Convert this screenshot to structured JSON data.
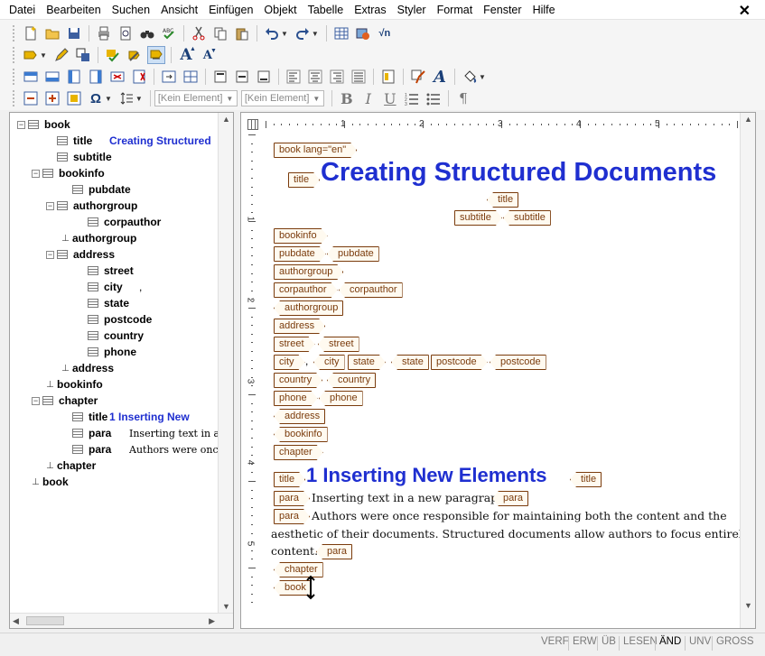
{
  "menu": [
    "Datei",
    "Bearbeiten",
    "Suchen",
    "Ansicht",
    "Einfügen",
    "Objekt",
    "Tabelle",
    "Extras",
    "Styler",
    "Format",
    "Fenster",
    "Hilfe"
  ],
  "window": {
    "close_glyph": "✕"
  },
  "toolbar": {
    "element_combo_1": "[Kein Element]",
    "element_combo_2": "[Kein Element]",
    "bold": "B",
    "italic": "I",
    "underline": "U",
    "pilcrow": "¶",
    "sqrt": "√n",
    "omega": "Ω"
  },
  "tree": {
    "nodes": [
      {
        "label": "book",
        "value": "",
        "expander": "minus"
      },
      {
        "label": "title",
        "value": "Creating Structured",
        "expander": "none"
      },
      {
        "label": "subtitle",
        "value": "",
        "expander": "none"
      },
      {
        "label": "bookinfo",
        "value": "",
        "expander": "minus"
      },
      {
        "label": "pubdate",
        "value": "",
        "expander": "none"
      },
      {
        "label": "authorgroup",
        "value": "",
        "expander": "minus"
      },
      {
        "label": "corpauthor",
        "value": "",
        "expander": "none"
      },
      {
        "label": "authorgroup",
        "value": "",
        "expander": "pin"
      },
      {
        "label": "address",
        "value": "",
        "expander": "minus"
      },
      {
        "label": "street",
        "value": "",
        "expander": "none"
      },
      {
        "label": "city",
        "value": ",",
        "expander": "none"
      },
      {
        "label": "state",
        "value": "",
        "expander": "none"
      },
      {
        "label": "postcode",
        "value": "",
        "expander": "none"
      },
      {
        "label": "country",
        "value": "",
        "expander": "none"
      },
      {
        "label": "phone",
        "value": "",
        "expander": "none"
      },
      {
        "label": "address",
        "value": "",
        "expander": "pin"
      },
      {
        "label": "bookinfo",
        "value": "",
        "expander": "pin"
      },
      {
        "label": "chapter",
        "value": "",
        "expander": "minus"
      },
      {
        "label": "title",
        "value": "1 Inserting New",
        "expander": "none"
      },
      {
        "label": "para",
        "value": "Inserting text in a n",
        "expander": "none"
      },
      {
        "label": "para",
        "value": "Authors were once",
        "expander": "none"
      },
      {
        "label": "chapter",
        "value": "",
        "expander": "pin"
      },
      {
        "label": "book",
        "value": "",
        "expander": "pin"
      }
    ]
  },
  "ruler": {
    "h_labels": [
      "1",
      "2",
      "3",
      "4",
      "5"
    ],
    "v_labels": [
      "1",
      "2",
      "3",
      "4",
      "5"
    ]
  },
  "doc": {
    "tags": {
      "book_open": "book lang=\"en\"",
      "title": "title",
      "subtitle": "subtitle",
      "bookinfo": "bookinfo",
      "pubdate": "pubdate",
      "authorgroup": "authorgroup",
      "corpauthor": "corpauthor",
      "address": "address",
      "street": "street",
      "city": "city",
      "state": "state",
      "postcode": "postcode",
      "country": "country",
      "phone": "phone",
      "chapter": "chapter",
      "para": "para",
      "book": "book"
    },
    "title_text": "Creating Structured Documents",
    "city_sep": ",",
    "chapter_title": "1 Inserting New Elements",
    "para1": "Inserting text in a new paragraph.",
    "para2_line1": "Authors were once responsible for maintaining both the content and the",
    "para2_line2": "aesthetic of their documents. Structured documents allow authors to focus entirely on",
    "para2_line3": "content."
  },
  "status": [
    "VERF",
    "ERW",
    "ÜB",
    "LESEN",
    "ÄND",
    "UNV",
    "GROSS"
  ],
  "status_active": "ÄND",
  "colors": {
    "accent": "#1f2fd0",
    "tag": "#7a3b0c"
  }
}
